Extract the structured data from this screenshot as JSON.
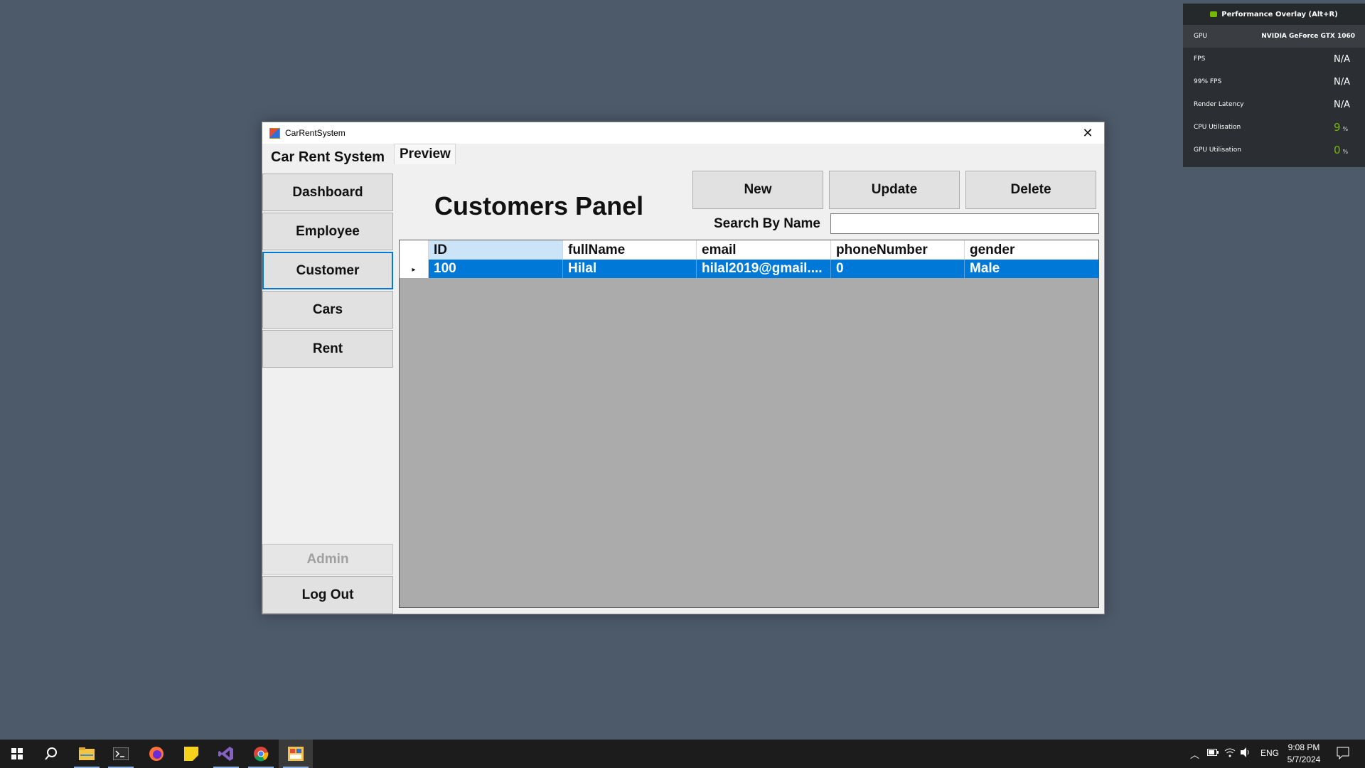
{
  "overlay": {
    "title": "Performance Overlay (Alt+R)",
    "gpu_label": "GPU",
    "gpu_value": "NVIDIA GeForce GTX 1060",
    "metrics": [
      {
        "label": "FPS",
        "value": "N/A",
        "unit": ""
      },
      {
        "label": "99% FPS",
        "value": "N/A",
        "unit": ""
      },
      {
        "label": "Render Latency",
        "value": "N/A",
        "unit": ""
      },
      {
        "label": "CPU Utilisation",
        "value": "9",
        "unit": "%"
      },
      {
        "label": "GPU Utilisation",
        "value": "0",
        "unit": "%"
      }
    ],
    "accent_color": "#76b900"
  },
  "window": {
    "title": "CarRentSystem",
    "close_glyph": "✕"
  },
  "sidebar": {
    "brand": "Car Rent System",
    "items": [
      {
        "label": "Dashboard"
      },
      {
        "label": "Employee"
      },
      {
        "label": "Customer",
        "active": true
      },
      {
        "label": "Cars"
      },
      {
        "label": "Rent"
      }
    ],
    "admin_label": "Admin",
    "logout_label": "Log Out"
  },
  "tabs": [
    {
      "label": "Preview"
    }
  ],
  "panel": {
    "title": "Customers Panel",
    "new_label": "New",
    "update_label": "Update",
    "delete_label": "Delete",
    "search_label": "Search By Name",
    "search_value": ""
  },
  "grid": {
    "columns": [
      "ID",
      "fullName",
      "email",
      "phoneNumber",
      "gender"
    ],
    "rows": [
      [
        "100",
        "Hilal",
        "hilal2019@gmail....",
        "0",
        "Male"
      ]
    ],
    "selection_color": "#0078d7"
  },
  "taskbar": {
    "language": "ENG",
    "time": "9:08 PM",
    "date": "5/7/2024"
  }
}
